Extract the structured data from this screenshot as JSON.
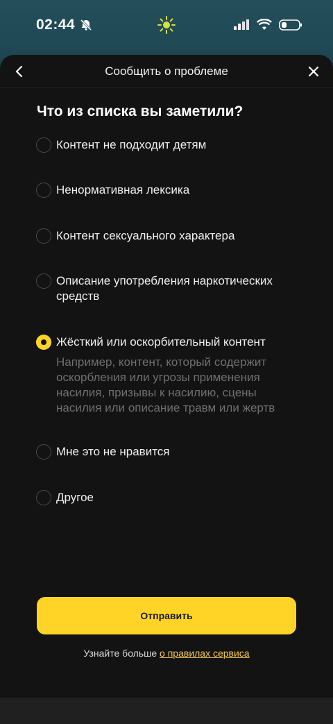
{
  "status_bar": {
    "time": "02:44"
  },
  "header": {
    "title": "Сообщить о проблеме"
  },
  "question": "Что из списка вы заметили?",
  "options": [
    {
      "label": "Контент не подходит детям",
      "selected": false
    },
    {
      "label": "Ненормативная лексика",
      "selected": false
    },
    {
      "label": "Контент сексуального характера",
      "selected": false
    },
    {
      "label": "Описание употребления наркотических средств",
      "selected": false
    },
    {
      "label": "Жёсткий или оскорбительный контент",
      "selected": true,
      "description": "Например, контент, который содержит оскорбления или угрозы применения насилия, призывы к насилию, сцены насилия или описание травм или жертв"
    },
    {
      "label": "Мне это не нравится",
      "selected": false
    },
    {
      "label": "Другое",
      "selected": false
    }
  ],
  "submit_label": "Отправить",
  "footer": {
    "text": "Узнайте больше",
    "link": "о правилах сервиса"
  },
  "colors": {
    "accent": "#ffd426",
    "link": "#f3c84a",
    "sheet_bg": "#131313",
    "backdrop": "#244e5a"
  }
}
